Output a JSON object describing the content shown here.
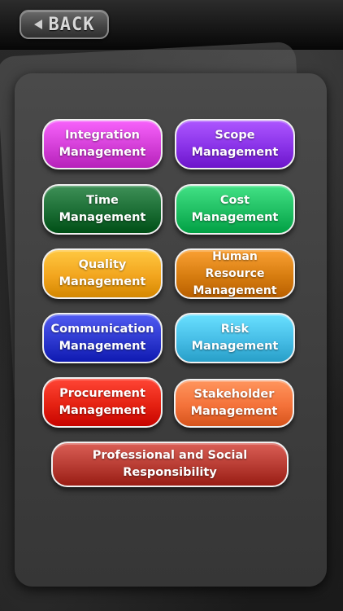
{
  "header": {
    "back_label": "BACK"
  },
  "menu": {
    "integration": {
      "line1": "Integration",
      "line2": "Management",
      "color": "#d43fd8"
    },
    "scope": {
      "line1": "Scope",
      "line2": "Management",
      "color": "#8a33e8"
    },
    "time": {
      "line1": "Time",
      "line2": "Management",
      "color": "#1b6d34"
    },
    "cost": {
      "line1": "Cost",
      "line2": "Management",
      "color": "#1fbe62"
    },
    "quality": {
      "line1": "Quality",
      "line2": "Management",
      "color": "#f2a51e"
    },
    "human_resource": {
      "line1": "Human Resource",
      "line2": "Management",
      "color": "#d77d10"
    },
    "communication": {
      "line1": "Communication",
      "line2": "Management",
      "color": "#2d38cf"
    },
    "risk": {
      "line1": "Risk",
      "line2": "Management",
      "color": "#46bde6"
    },
    "procurement": {
      "line1": "Procurement",
      "line2": "Management",
      "color": "#e52212"
    },
    "stakeholder": {
      "line1": "Stakeholder",
      "line2": "Management",
      "color": "#f4723a"
    },
    "professional": {
      "line1": "Professional and Social",
      "line2": "Responsibility",
      "color": "#b73b32"
    }
  }
}
